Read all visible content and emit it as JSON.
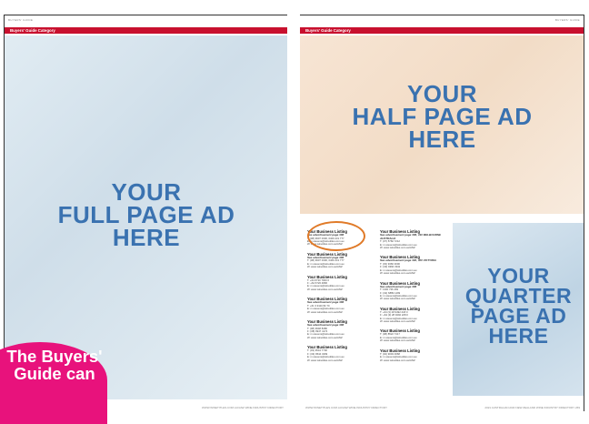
{
  "left_page": {
    "running_head": "BUYERS' GUIDE",
    "category": "Buyers' Guide Category",
    "ad_text": [
      "YOUR",
      "FULL PAGE AD",
      "HERE"
    ],
    "folio": "WWW.WINETITLES.COM.AU/ANZ WINE INDUSTRY DIRECTORY"
  },
  "right_page": {
    "running_head": "BUYERS' GUIDE",
    "category": "Buyers' Guide Category",
    "half_ad_text": [
      "YOUR",
      "HALF PAGE AD",
      "HERE"
    ],
    "quarter_ad_text": [
      "YOUR",
      "QUARTER",
      "PAGE AD",
      "HERE"
    ],
    "folio_left": "WWW.WINETITLES.COM.AU/ANZ WINE INDUSTRY DIRECTORY",
    "folio_right": "2021 AUSTRALIAN AND NEW ZEALAND WINE INDUSTRY DIRECTORY 269"
  },
  "listings": {
    "col1": [
      {
        "title": "Your Business Listing",
        "sub": "See advertisement page 386",
        "lines": [
          "T: (08) 9907 0300, 0409 431 777",
          "E: m.stevens@winetitles.com.au",
          "W: www.winetitles.com.au/ANZ"
        ]
      },
      {
        "title": "Your Business Listing",
        "sub": "See advertisement page 386",
        "lines": [
          "T: (08) 9907 0300, 0409 431 777",
          "E: m.stevens@winetitles.com.au",
          "W: www.winetitles.com.au/ANZ"
        ]
      },
      {
        "title": "Your Business Listing",
        "sub": "",
        "lines": [
          "T: +64 6720 7000 0",
          "F: +64 6720 4890",
          "E: m.stevens@winetitles.com.au",
          "W: www.winetitles.com.au/ANZ"
        ]
      },
      {
        "title": "Your Business Listing",
        "sub": "See advertisement page 386",
        "lines": [
          "T: +61 3 9110 82 70",
          "E: m.stevens@winetitles.com.au",
          "W: www.winetitles.com.au/ANZ"
        ]
      },
      {
        "title": "Your Business Listing",
        "sub": "See advertisement page 386",
        "lines": [
          "T: (08) 9948 8486",
          "F: (08) 9947 4174",
          "E: m.stevens@winetitles.com.au",
          "W: www.winetitles.com.au/ANZ"
        ]
      },
      {
        "title": "Your Business Listing",
        "sub": "",
        "lines": [
          "T: (03) 9544 7700",
          "F: (03) 9544 3299",
          "E: m.stevens@winetitles.com.au",
          "W: www.winetitles.com.au/ANZ"
        ]
      }
    ],
    "col2": [
      {
        "title": "Your Business Listing",
        "sub": "See advertisement page 386, 330 MELBOURNE AUSTRALIA",
        "lines": [
          "T: (07) 5782 7212",
          "E: m.stevens@winetitles.com.au",
          "W: www.winetitles.com.au/ANZ"
        ]
      },
      {
        "title": "Your Business Listing",
        "sub": "See advertisement page 400, 300 VICTORIA",
        "lines": [
          "T: (03) 9366 3000",
          "F: (03) 9366 3332",
          "E: m.stevens@winetitles.com.au",
          "W: www.winetitles.com.au/ANZ"
        ]
      },
      {
        "title": "Your Business Listing",
        "sub": "See advertisement page 386",
        "lines": [
          "T: 1300 736 469",
          "F: (02) 6889 1299",
          "E: m.stevens@winetitles.com.au",
          "W: www.winetitles.com.au/ANZ"
        ]
      },
      {
        "title": "Your Business Listing",
        "sub": "",
        "lines": [
          "T: +64 (3) 28 9492 218 0",
          "F: +64 (3) 28 9492 228 0",
          "E: m.stevens@winetitles.com.au",
          "W: www.winetitles.com.au/ANZ"
        ]
      },
      {
        "title": "Your Business Listing",
        "sub": "",
        "lines": [
          "T: (08) 8522 7417",
          "E: m.stevens@winetitles.com.au",
          "W: www.winetitles.com.au/ANZ"
        ]
      },
      {
        "title": "Your Business Listing",
        "sub": "",
        "lines": [
          "T: (02) 9049 0068",
          "E: m.stevens@winetitles.com.au",
          "W: www.winetitles.com.au/ANZ"
        ]
      }
    ]
  },
  "callout": {
    "text": "The Buyers' Guide can"
  },
  "colors": {
    "category_bar": "#c8102e",
    "ad_text": "#3a72b0",
    "highlight_circle": "#e07a28",
    "callout": "#e8127c"
  }
}
